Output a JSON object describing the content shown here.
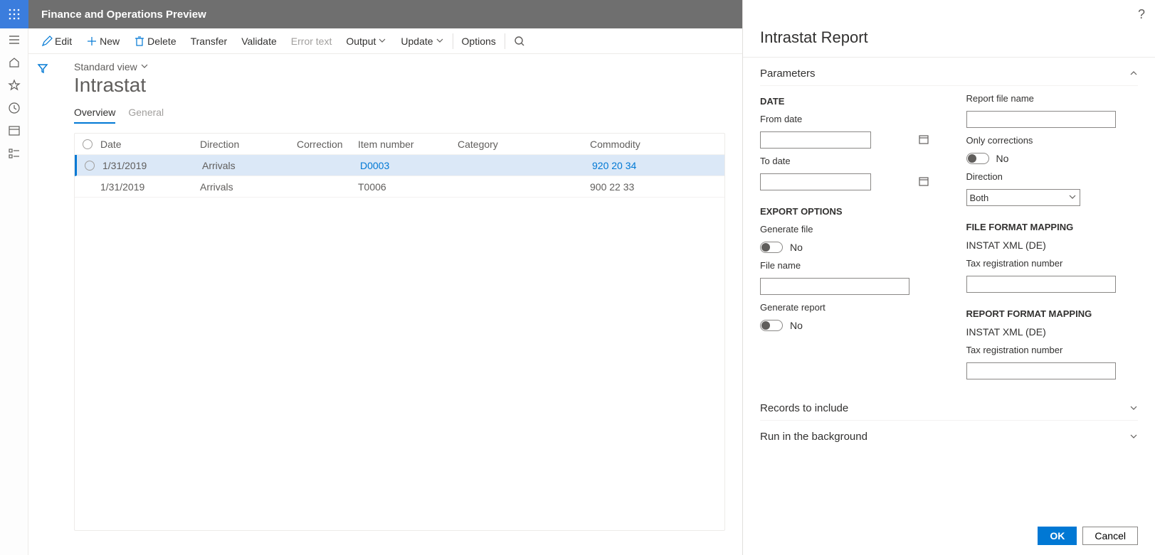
{
  "app_title": "Finance and Operations Preview",
  "toolbar": {
    "edit": "Edit",
    "new": "New",
    "delete": "Delete",
    "transfer": "Transfer",
    "validate": "Validate",
    "error_text": "Error text",
    "output": "Output",
    "update": "Update",
    "options": "Options"
  },
  "view_picker": "Standard view",
  "page_title": "Intrastat",
  "tabs": {
    "overview": "Overview",
    "general": "General"
  },
  "grid": {
    "headers": {
      "date": "Date",
      "direction": "Direction",
      "correction": "Correction",
      "item_number": "Item number",
      "category": "Category",
      "commodity": "Commodity"
    },
    "rows": [
      {
        "date": "1/31/2019",
        "direction": "Arrivals",
        "correction": "",
        "item_number": "D0003",
        "category": "",
        "commodity": "920 20 34",
        "selected": true
      },
      {
        "date": "1/31/2019",
        "direction": "Arrivals",
        "correction": "",
        "item_number": "T0006",
        "category": "",
        "commodity": "900 22 33",
        "selected": false
      }
    ]
  },
  "panel": {
    "title": "Intrastat Report",
    "parameters_label": "Parameters",
    "date_group": "DATE",
    "from_date": "From date",
    "to_date": "To date",
    "export_options_group": "EXPORT OPTIONS",
    "generate_file": "Generate file",
    "no": "No",
    "file_name": "File name",
    "generate_report": "Generate report",
    "report_file_name": "Report file name",
    "only_corrections": "Only corrections",
    "direction_label": "Direction",
    "direction_value": "Both",
    "file_format_mapping": "FILE FORMAT MAPPING",
    "instat_xml": "INSTAT XML (DE)",
    "tax_reg_num": "Tax registration number",
    "report_format_mapping": "REPORT FORMAT MAPPING",
    "records_to_include": "Records to include",
    "run_in_background": "Run in the background",
    "ok": "OK",
    "cancel": "Cancel"
  }
}
